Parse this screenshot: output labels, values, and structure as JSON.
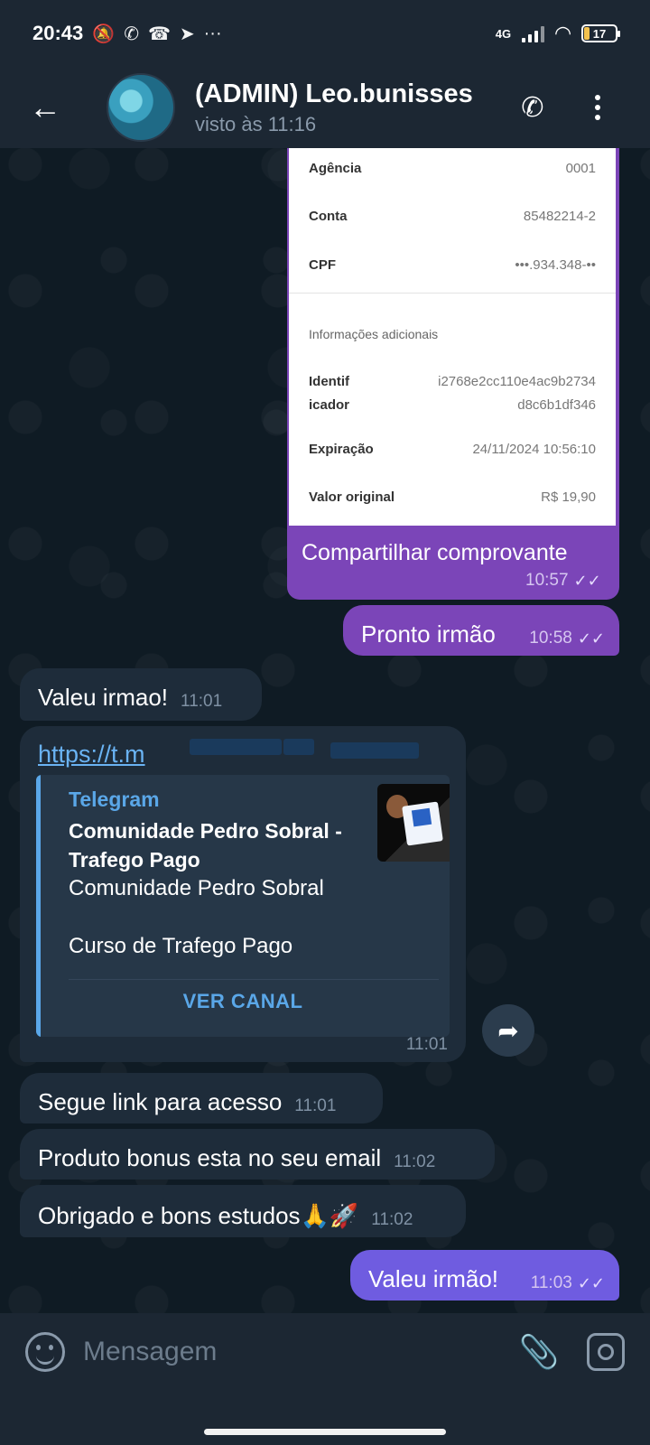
{
  "status_bar": {
    "time": "20:43",
    "network": "4G",
    "battery": "17",
    "icons": [
      "mute-icon",
      "whatsapp-icon",
      "missed-call-icon",
      "telegram-icon",
      "more-dots-icon",
      "signal-icon",
      "wifi-icon",
      "battery-icon"
    ]
  },
  "header": {
    "title": "(ADMIN) Leo.bunisses",
    "subtitle": "visto às 11:16",
    "icons": [
      "back-arrow-icon",
      "phone-icon",
      "kebab-menu-icon"
    ]
  },
  "receipt": {
    "rows": [
      {
        "k": "Agência",
        "v": "0001"
      },
      {
        "k": "Conta",
        "v": "85482214-2"
      },
      {
        "k": "CPF",
        "v": "•••.934.348-••"
      }
    ],
    "section_title": "Informações adicionais",
    "identifier_label_1": "Identif",
    "identifier_label_2": "icador",
    "identifier_value_1": "i2768e2cc110e4ac9b2734",
    "identifier_value_2": "d8c6b1df346",
    "expiration_label": "Expiração",
    "expiration_value": "24/11/2024 10:56:10",
    "original_value_label": "Valor original",
    "original_value": "R$ 19,90",
    "caption": "Compartilhar comprovante",
    "time": "10:57"
  },
  "messages": [
    {
      "dir": "out",
      "text": "Pronto irmão",
      "time": "10:58"
    },
    {
      "dir": "in",
      "text": "Valeu irmao!",
      "time": "11:01"
    },
    {
      "dir": "in",
      "text": "Segue link para acesso",
      "time": "11:01"
    },
    {
      "dir": "in",
      "text": "Produto bonus esta no seu email",
      "time": "11:02"
    },
    {
      "dir": "in",
      "text": "Obrigado e bons estudos🙏🚀",
      "time": "11:02"
    },
    {
      "dir": "out",
      "text": "Valeu irmão!",
      "time": "11:03"
    }
  ],
  "link_message": {
    "url": "https://t.m",
    "site": "Telegram",
    "title": "Comunidade Pedro Sobral - Trafego Pago",
    "desc_line_1": "Comunidade Pedro Sobral",
    "desc_line_2": "Curso de Trafego Pago",
    "button": "VER CANAL",
    "time": "11:01"
  },
  "input": {
    "placeholder": "Mensagem"
  },
  "colors": {
    "outgoing_bubble": "#7b45b8",
    "incoming_bubble": "#1e2c3a",
    "link": "#6ab3f3",
    "background": "#0f1b24"
  }
}
